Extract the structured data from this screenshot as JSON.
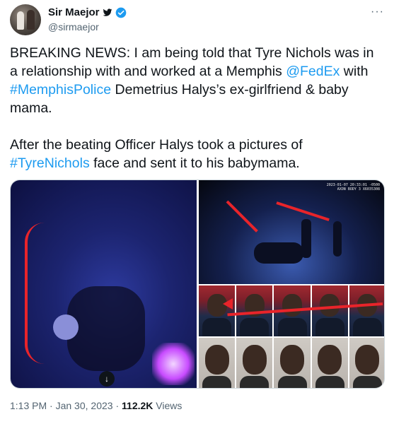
{
  "author": {
    "name": "Sir Maejor",
    "handle": "@sirmaejor",
    "verified_color": "#1d9bf0"
  },
  "more_label": "···",
  "tweet": {
    "p1_pre": "BREAKING NEWS: I am being told that Tyre Nichols was in a relationship with and worked at a Memphis ",
    "p1_link1": "@FedEx",
    "p1_mid": " with ",
    "p1_link2": "#MemphisPolice",
    "p1_post": " Demetrius Halys’s ex-girlfriend & baby mama.",
    "p2_pre": "After the beating Officer Halys took a pictures of ",
    "p2_link": "#TyreNichols",
    "p2_post": " face and sent it to his babymama."
  },
  "media": {
    "bodycam_stamp": "2023-01-07 20:33:01 -0500\nAXON BODY 3 X6035308",
    "download_icon": "arrow-down-icon"
  },
  "meta": {
    "time": "1:13 PM",
    "date": "Jan 30, 2023",
    "views_count": "112.2K",
    "views_label": " Views"
  },
  "colors": {
    "link": "#1d9bf0",
    "text": "#0f1419",
    "secondary": "#536471",
    "arrow_red": "#e8242a"
  }
}
